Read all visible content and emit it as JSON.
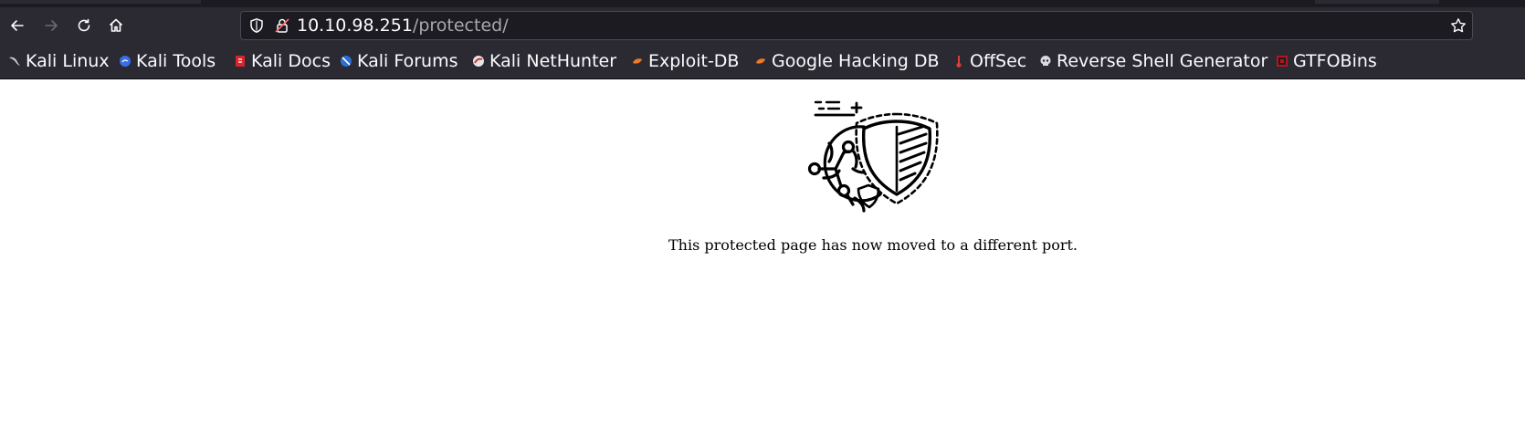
{
  "browser": {
    "url_host": "10.10.98.251",
    "url_path": "/protected/",
    "toolbar_icons": [
      "back-icon",
      "forward-icon",
      "reload-icon",
      "home-icon",
      "shield-icon",
      "lock-icon",
      "star-icon"
    ]
  },
  "bookmarks": [
    {
      "label": "Kali Linux",
      "icon": "kali-dragon-icon"
    },
    {
      "label": "Kali Tools",
      "icon": "kali-tools-icon"
    },
    {
      "label": "Kali Docs",
      "icon": "kali-docs-icon"
    },
    {
      "label": "Kali Forums",
      "icon": "kali-forums-icon"
    },
    {
      "label": "Kali NetHunter",
      "icon": "kali-nethunter-icon"
    },
    {
      "label": "Exploit-DB",
      "icon": "exploit-db-icon"
    },
    {
      "label": "Google Hacking DB",
      "icon": "ghdb-icon"
    },
    {
      "label": "OffSec",
      "icon": "offsec-icon"
    },
    {
      "label": "Reverse Shell Generator",
      "icon": "skull-icon"
    },
    {
      "label": "GTFOBins",
      "icon": "gtfobins-icon"
    }
  ],
  "page": {
    "illustration": "globe-shield-icon",
    "message": "This protected page has now moved to a different port."
  },
  "colors": {
    "chrome_dark": "#1c1b22",
    "toolbar": "#2b2a33",
    "text_light": "#fbfbfe",
    "url_path": "#a8a8b0"
  }
}
